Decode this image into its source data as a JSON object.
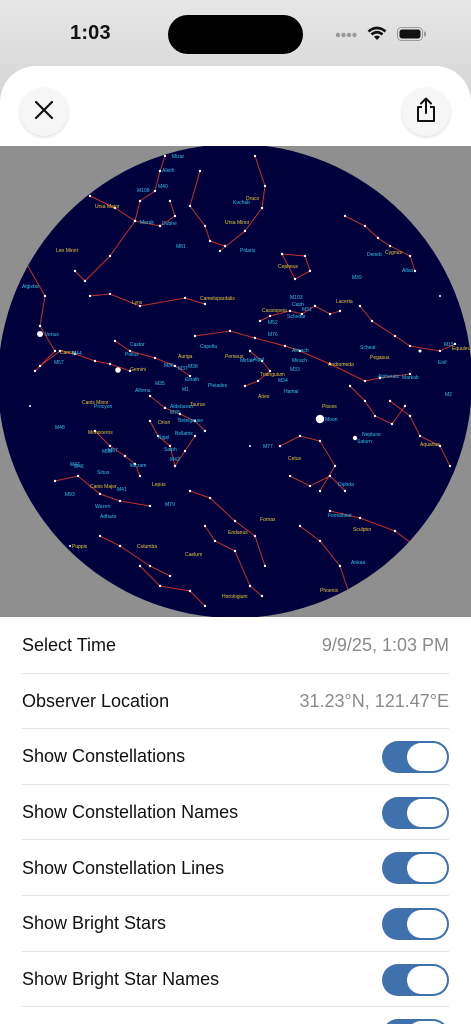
{
  "status_bar": {
    "time": "1:03",
    "icons": [
      "signal-icon",
      "wifi-icon",
      "battery-icon"
    ]
  },
  "header": {
    "close_icon": "close-icon",
    "share_icon": "share-icon"
  },
  "colors": {
    "sky": "#00003c",
    "constellation_line": "#c4302b",
    "star": "#ffffff",
    "label_cyan": "#2ec4e8",
    "label_yellow": "#e5c936",
    "toggle_on": "#3f72ad"
  },
  "sky_map": {
    "labels": [
      {
        "text": "Mizar",
        "c": "cyan"
      },
      {
        "text": "Alioth",
        "c": "cyan"
      },
      {
        "text": "M40",
        "c": "cyan"
      },
      {
        "text": "Ursa Major",
        "c": "yellow"
      },
      {
        "text": "M108",
        "c": "cyan"
      },
      {
        "text": "Merak",
        "c": "cyan"
      },
      {
        "text": "Dubhe",
        "c": "cyan"
      },
      {
        "text": "M81",
        "c": "cyan"
      },
      {
        "text": "Draco",
        "c": "yellow"
      },
      {
        "text": "Kochab",
        "c": "cyan"
      },
      {
        "text": "Ursa Minor",
        "c": "yellow"
      },
      {
        "text": "Polaris",
        "c": "cyan"
      },
      {
        "text": "Leo Minor",
        "c": "yellow"
      },
      {
        "text": "Cepheus",
        "c": "yellow"
      },
      {
        "text": "Deneb",
        "c": "cyan"
      },
      {
        "text": "Cygnus",
        "c": "yellow"
      },
      {
        "text": "Altair",
        "c": "cyan"
      },
      {
        "text": "M39",
        "c": "cyan"
      },
      {
        "text": "Algieba",
        "c": "cyan"
      },
      {
        "text": "Lynx",
        "c": "yellow"
      },
      {
        "text": "Camelopardalis",
        "c": "yellow"
      },
      {
        "text": "Lacerta",
        "c": "yellow"
      },
      {
        "text": "Caph",
        "c": "cyan"
      },
      {
        "text": "Cassiopeia",
        "c": "yellow"
      },
      {
        "text": "Schedar",
        "c": "cyan"
      },
      {
        "text": "M52",
        "c": "cyan"
      },
      {
        "text": "Venus",
        "c": "cyan"
      },
      {
        "text": "Castor",
        "c": "cyan"
      },
      {
        "text": "Capella",
        "c": "cyan"
      },
      {
        "text": "Auriga",
        "c": "yellow"
      },
      {
        "text": "Perseus",
        "c": "yellow"
      },
      {
        "text": "Mirfak",
        "c": "cyan"
      },
      {
        "text": "Almach",
        "c": "cyan"
      },
      {
        "text": "Mirach",
        "c": "cyan"
      },
      {
        "text": "Andromeda",
        "c": "yellow"
      },
      {
        "text": "Alpheratz",
        "c": "cyan"
      },
      {
        "text": "Scheat",
        "c": "cyan"
      },
      {
        "text": "Pegasus",
        "c": "yellow"
      },
      {
        "text": "Markab",
        "c": "cyan"
      },
      {
        "text": "Enif",
        "c": "cyan"
      },
      {
        "text": "Equuleus",
        "c": "yellow"
      },
      {
        "text": "Cancer",
        "c": "yellow"
      },
      {
        "text": "M44",
        "c": "cyan"
      },
      {
        "text": "Pollux",
        "c": "cyan"
      },
      {
        "text": "Gemini",
        "c": "yellow"
      },
      {
        "text": "Alhena",
        "c": "cyan"
      },
      {
        "text": "M35",
        "c": "cyan"
      },
      {
        "text": "Elnath",
        "c": "cyan"
      },
      {
        "text": "Triangulum",
        "c": "yellow"
      },
      {
        "text": "M33",
        "c": "cyan"
      },
      {
        "text": "Algol",
        "c": "cyan"
      },
      {
        "text": "M34",
        "c": "cyan"
      },
      {
        "text": "Pleiades",
        "c": "cyan"
      },
      {
        "text": "Hamal",
        "c": "cyan"
      },
      {
        "text": "Aries",
        "c": "yellow"
      },
      {
        "text": "Pisces",
        "c": "yellow"
      },
      {
        "text": "Moon",
        "c": "cyan"
      },
      {
        "text": "Neptune",
        "c": "cyan"
      },
      {
        "text": "Saturn",
        "c": "cyan"
      },
      {
        "text": "Aquarius",
        "c": "yellow"
      },
      {
        "text": "Canis Minor",
        "c": "yellow"
      },
      {
        "text": "Procyon",
        "c": "cyan"
      },
      {
        "text": "Taurus",
        "c": "yellow"
      },
      {
        "text": "Aldebaran",
        "c": "cyan"
      },
      {
        "text": "Orion",
        "c": "yellow"
      },
      {
        "text": "Betelgeuse",
        "c": "cyan"
      },
      {
        "text": "Bellatrix",
        "c": "cyan"
      },
      {
        "text": "Rigel",
        "c": "cyan"
      },
      {
        "text": "Saiph",
        "c": "cyan"
      },
      {
        "text": "M42",
        "c": "cyan"
      },
      {
        "text": "M77",
        "c": "cyan"
      },
      {
        "text": "Cetus",
        "c": "yellow"
      },
      {
        "text": "Diphda",
        "c": "cyan"
      },
      {
        "text": "M48",
        "c": "cyan"
      },
      {
        "text": "Monoceros",
        "c": "yellow"
      },
      {
        "text": "M50",
        "c": "cyan"
      },
      {
        "text": "Mirzam",
        "c": "cyan"
      },
      {
        "text": "Lepus",
        "c": "yellow"
      },
      {
        "text": "M79",
        "c": "cyan"
      },
      {
        "text": "Canis Major",
        "c": "yellow"
      },
      {
        "text": "Sirius",
        "c": "cyan"
      },
      {
        "text": "M41",
        "c": "cyan"
      },
      {
        "text": "M93",
        "c": "cyan"
      },
      {
        "text": "Wezen",
        "c": "cyan"
      },
      {
        "text": "Adhara",
        "c": "cyan"
      },
      {
        "text": "Puppis",
        "c": "yellow"
      },
      {
        "text": "Columba",
        "c": "yellow"
      },
      {
        "text": "Eridanus",
        "c": "yellow"
      },
      {
        "text": "Fornax",
        "c": "yellow"
      },
      {
        "text": "Sculptor",
        "c": "yellow"
      },
      {
        "text": "Caelum",
        "c": "yellow"
      },
      {
        "text": "Horologium",
        "c": "yellow"
      },
      {
        "text": "Phoenix",
        "c": "yellow"
      },
      {
        "text": "Ankaa",
        "c": "cyan"
      },
      {
        "text": "Fomalhaut",
        "c": "cyan"
      },
      {
        "text": "M57",
        "c": "cyan"
      },
      {
        "text": "M36",
        "c": "cyan"
      },
      {
        "text": "M37",
        "c": "cyan"
      },
      {
        "text": "M38",
        "c": "cyan"
      },
      {
        "text": "M76",
        "c": "cyan"
      },
      {
        "text": "M31",
        "c": "cyan"
      },
      {
        "text": "M103",
        "c": "cyan"
      },
      {
        "text": "M15",
        "c": "cyan"
      },
      {
        "text": "M1",
        "c": "cyan"
      },
      {
        "text": "M78",
        "c": "cyan"
      },
      {
        "text": "M47",
        "c": "cyan"
      },
      {
        "text": "M46",
        "c": "cyan"
      },
      {
        "text": "M67",
        "c": "cyan"
      },
      {
        "text": "M2",
        "c": "cyan"
      },
      {
        "text": "M30",
        "c": "cyan"
      }
    ]
  },
  "settings": {
    "rows": [
      {
        "label": "Select Time",
        "value": "9/9/25, 1:03 PM"
      },
      {
        "label": "Observer Location",
        "value": "31.23°N, 121.47°E"
      },
      {
        "label": "Show Constellations",
        "toggle": true
      },
      {
        "label": "Show Constellation Names",
        "toggle": true
      },
      {
        "label": "Show Constellation Lines",
        "toggle": true
      },
      {
        "label": "Show Bright Stars",
        "toggle": true
      },
      {
        "label": "Show Bright Star Names",
        "toggle": true
      },
      {
        "label": "",
        "toggle": true
      }
    ]
  }
}
